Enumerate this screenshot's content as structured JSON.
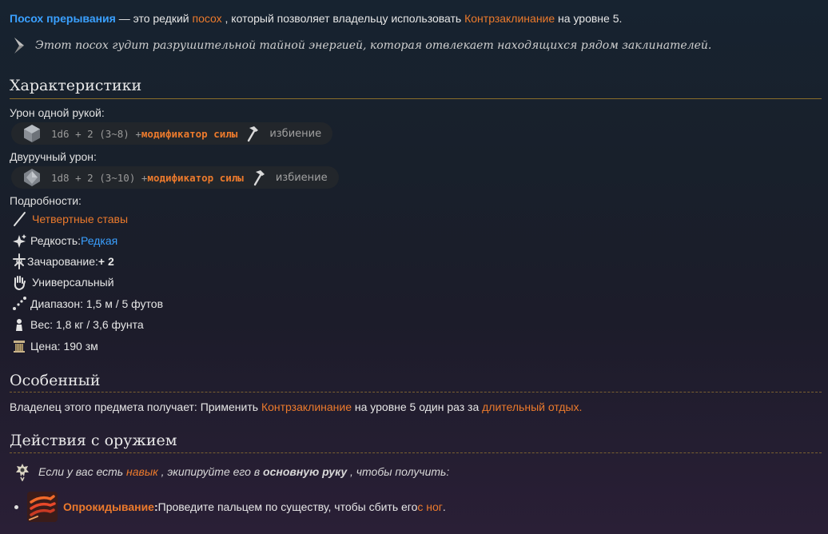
{
  "intro": {
    "item_name": "Посох прерывания",
    "text_1": " — это редкий ",
    "link_type": "посох",
    "text_2": " , который позволяет владельцу использовать ",
    "link_spell": "Контрзаклинание",
    "text_3": " на уровне 5."
  },
  "quote": "Этот посох гудит разрушительной тайной энергией, которая отвлекает находящихся рядом заклинателей.",
  "characteristics": {
    "heading": "Характеристики",
    "one_hand_label": "Урон одной рукой:",
    "one_hand": {
      "dice": "1d6 + 2 (3~8) + ",
      "modifier": "модификатор силы",
      "type": "избиение"
    },
    "two_hand_label": "Двуручный урон:",
    "two_hand": {
      "dice": "1d8 + 2 (3~10) + ",
      "modifier": "модификатор силы",
      "type": "избиение"
    },
    "details_label": "Подробности:",
    "details": {
      "category": "Четвертные ставы",
      "rarity_label": "Редкость: ",
      "rarity_value": "Редкая",
      "enchant_label": "Зачарование: ",
      "enchant_value": "+ 2",
      "handedness": "Универсальный",
      "range": "Диапазон: 1,5 м / 5 футов",
      "weight": "Вес: 1,8 кг / 3,6 фунта",
      "price": "Цена: 190 зм"
    }
  },
  "special": {
    "heading": "Особенный",
    "text_1": "Владелец этого предмета получает: Применить ",
    "link_spell": "Контрзаклинание",
    "text_2": " на уровне 5 один раз за ",
    "link_rest": "длительный отдых."
  },
  "weapon_actions": {
    "heading": "Действия с оружием",
    "note_1": "Если у вас есть ",
    "note_link": "навык",
    "note_2": " , экипируйте его в ",
    "note_bold": "основную руку",
    "note_3": " , чтобы получить:",
    "action_name": "Опрокидывание",
    "action_sep": " : ",
    "action_text": "Проведите пальцем по существу, чтобы сбить его ",
    "action_link": "с ног",
    "action_end": " ."
  },
  "colors": {
    "link_blue": "#3aa0ff",
    "link_orange": "#ec7a2c",
    "rule_gold": "#8a6d2a"
  }
}
